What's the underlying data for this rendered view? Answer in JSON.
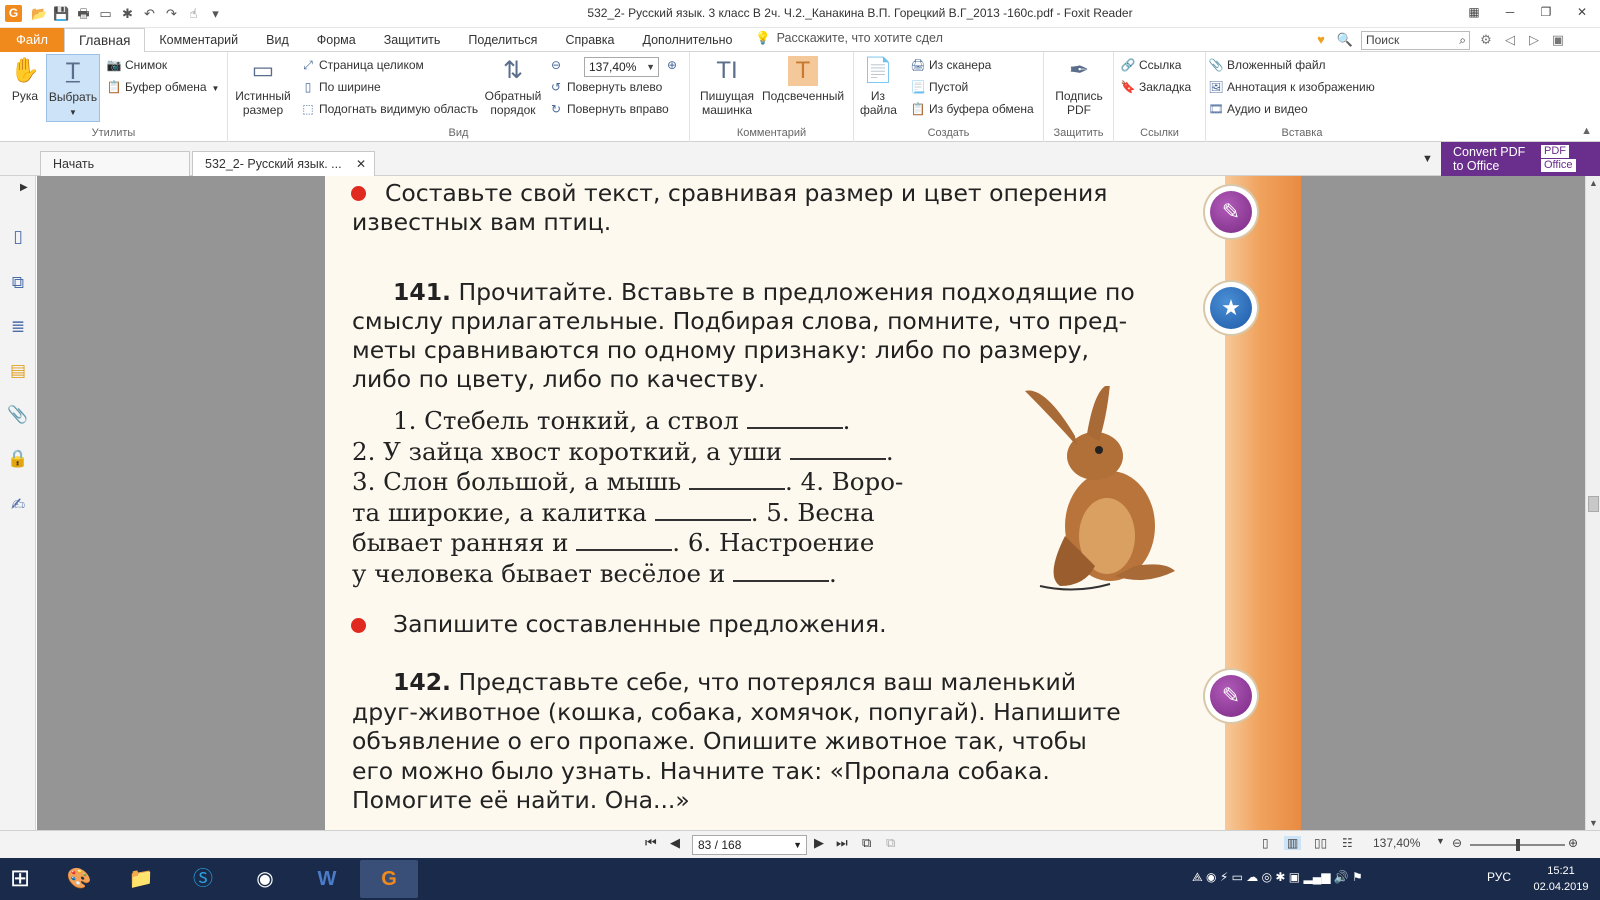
{
  "window": {
    "title": "532_2- Русский язык. 3 класс В 2ч. Ч.2._Канакина В.П. Горецкий В.Г_2013 -160с.pdf - Foxit Reader",
    "logo": "G"
  },
  "menu": {
    "file": "Файл",
    "tabs": [
      "Главная",
      "Комментарий",
      "Вид",
      "Форма",
      "Защитить",
      "Поделиться",
      "Справка",
      "Дополнительно"
    ],
    "tell_me": "Расскажите, что хотите сдел",
    "search_placeholder": "Поиск"
  },
  "ribbon": {
    "groups": {
      "utilities": "Утилиты",
      "view": "Вид",
      "comment": "Комментарий",
      "create": "Создать",
      "protect": "Защитить",
      "links": "Ссылки",
      "insert": "Вставка"
    },
    "hand": "Рука",
    "select": "Выбрать",
    "snapshot": "Снимок",
    "clipboard": "Буфер обмена",
    "actual_size_1": "Истинный",
    "actual_size_2": "размер",
    "fit_page": "Страница целиком",
    "fit_width": "По ширине",
    "fit_visible": "Подогнать видимую область",
    "reverse_1": "Обратный",
    "reverse_2": "порядок",
    "zoom_value": "137,40%",
    "rotate_left": "Повернуть влево",
    "rotate_right": "Повернуть вправо",
    "typewriter_1": "Пишущая",
    "typewriter_2": "машинка",
    "highlight": "Подсвеченный",
    "from_file_1": "Из",
    "from_file_2": "файла",
    "from_scanner": "Из сканера",
    "blank": "Пустой",
    "from_clipboard": "Из буфера обмена",
    "sign_1": "Подпись",
    "sign_2": "PDF",
    "link": "Ссылка",
    "bookmark": "Закладка",
    "attach_file": "Вложенный файл",
    "image_annot": "Аннотация к изображению",
    "audio_video": "Аудио и видео"
  },
  "tabs": {
    "start": "Начать",
    "document": "532_2- Русский язык. ...",
    "convert_1": "Convert PDF",
    "convert_2": "to Office",
    "convert_pdf": "PDF",
    "convert_office": "Office"
  },
  "page": {
    "intro_line1": "Составьте  свой  текст,  сравнивая  размер  и  цвет  оперения",
    "intro_line2": "известных  вам  птиц.",
    "ex141_num": "141.",
    "ex141_line1": " Прочитайте.  Вставьте  в  предложения  подходящие  по",
    "ex141_line2": "смыслу  прилагательные.  Подбирая  слова,  помните,  что  пред-",
    "ex141_line3": "меты  сравниваются  по  одному  признаку:  либо  по  размеру,",
    "ex141_line4": "либо  по  цвету,  либо  по  качеству.",
    "s1": "1. Стебель   тонкий,   а   ствол",
    "s2": "2. У  зайца  хвост  короткий,  а  уши",
    "s3a": "3. Слон  большой,  а  мышь",
    "s3b": ". 4. Воро-",
    "s4a": "та  широкие,  а  калитка",
    "s4b": ". 5. Весна",
    "s5a": "бывает   ранняя   и",
    "s5b": ".   6. Настроение",
    "s6a": "у  человека  бывает  весёлое  и",
    "dot": ".",
    "task_write": "Запишите  составленные  предложения.",
    "ex142_num": "142.",
    "ex142_line1": " Представьте  себе,  что  потерялся  ваш  маленький",
    "ex142_line2": "друг-животное  (кошка,  собака,  хомячок,  попугай).  Напишите",
    "ex142_line3": "объявление  о  его  пропаже.  Опишите  животное  так,  чтобы",
    "ex142_line4": "его  можно  было  узнать.  Начните  так:  «Пропала  собака.",
    "ex142_line5": "Помогите  её  найти.  Она...»"
  },
  "status": {
    "page_field": "83 / 168",
    "zoom": "137,40%"
  },
  "taskbar": {
    "lang": "РУС",
    "time": "15:21",
    "date": "02.04.2019"
  },
  "colors": {
    "accent": "#f08a1c",
    "convert_bg": "#6a2e8c",
    "taskbar": "#1a2a4a",
    "bullet": "#e02a20"
  }
}
